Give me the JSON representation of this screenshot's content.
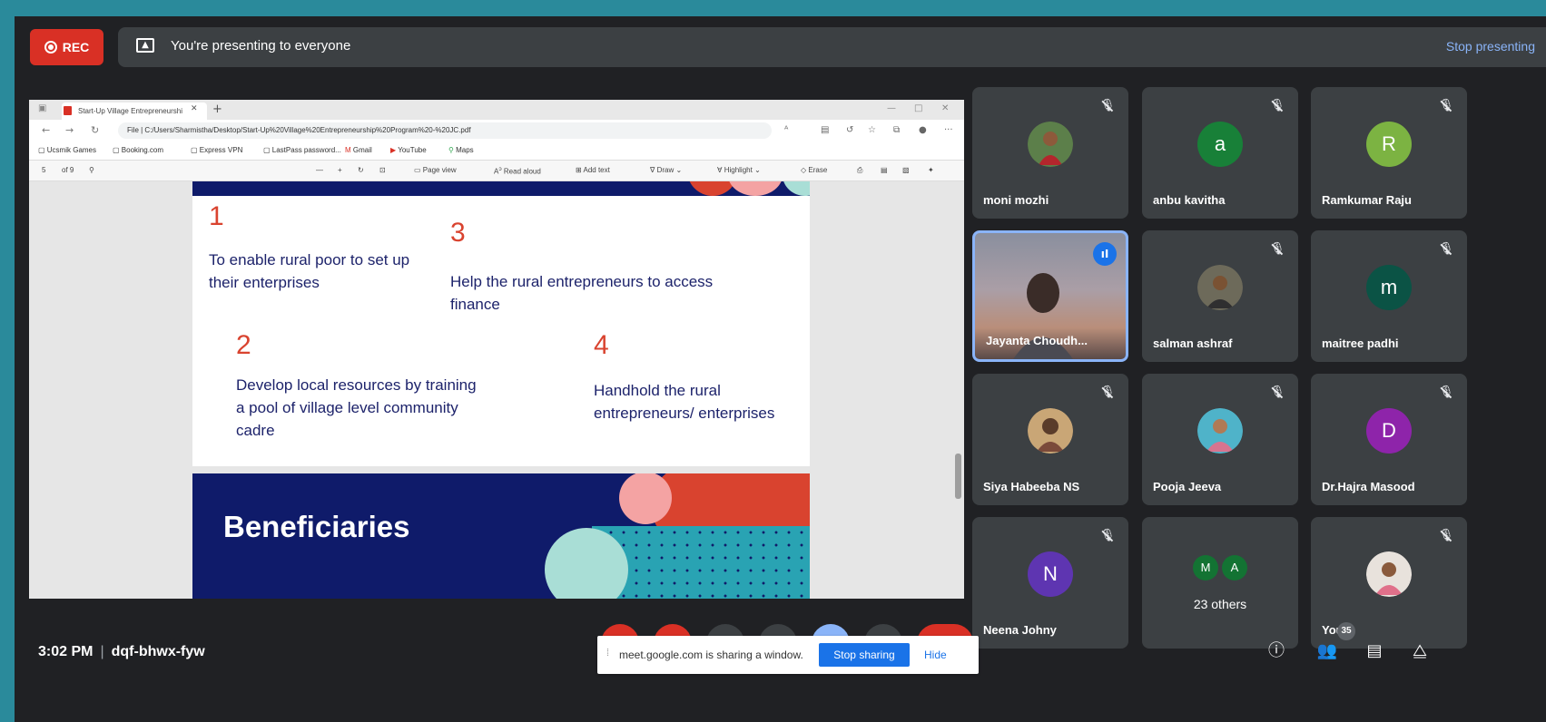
{
  "banner": {
    "rec_label": "REC",
    "presenting_text": "You're presenting to everyone",
    "stop_presenting": "Stop presenting"
  },
  "browser": {
    "tab_title": "Start-Up Village Entrepreneurshi",
    "url": "File  |  C:/Users/Sharmistha/Desktop/Start-Up%20Village%20Entrepreneurship%20Program%20-%20JC.pdf",
    "bookmarks": [
      "Ucsmik Games",
      "Booking.com",
      "Express VPN",
      "LastPass password...",
      "Gmail",
      "YouTube",
      "Maps"
    ],
    "pdf_toolbar": {
      "page": "5",
      "of_pages": "of 9",
      "page_view": "Page view",
      "read_aloud": "Read aloud",
      "add_text": "Add text",
      "draw": "Draw",
      "highlight": "Highlight",
      "erase": "Erase"
    }
  },
  "slide": {
    "objectives": [
      {
        "num": "1",
        "text": "To enable rural poor to set up their enterprises"
      },
      {
        "num": "2",
        "text": "Develop local resources by training a pool of village level community cadre"
      },
      {
        "num": "3",
        "text": "Help the rural entrepreneurs to access finance"
      },
      {
        "num": "4",
        "text": "Handhold the rural entrepreneurs/ enterprises"
      }
    ],
    "next_heading": "Beneficiaries",
    "colors": {
      "navy": "#0f1b6a",
      "red": "#d9432f",
      "pink": "#f4a3a3",
      "mint": "#a9ded6",
      "teal": "#29a3b3"
    }
  },
  "participants": [
    {
      "name": "moni mozhi",
      "avatar": "photo",
      "muted": true
    },
    {
      "name": "anbu kavitha",
      "avatar": "a",
      "color": "#188038",
      "muted": true
    },
    {
      "name": "Ramkumar Raju",
      "avatar": "R",
      "color": "#7cb342",
      "muted": true
    },
    {
      "name": "Jayanta Choudh...",
      "avatar": "video",
      "speaking": true
    },
    {
      "name": "salman ashraf",
      "avatar": "photo",
      "muted": true
    },
    {
      "name": "maitree padhi",
      "avatar": "m",
      "color": "#0b5345",
      "muted": true
    },
    {
      "name": "Siya Habeeba NS",
      "avatar": "photo",
      "muted": true
    },
    {
      "name": "Pooja Jeeva",
      "avatar": "photo",
      "muted": true
    },
    {
      "name": "Dr.Hajra Masood",
      "avatar": "D",
      "color": "#8e24aa",
      "muted": true
    },
    {
      "name": "Neena Johny",
      "avatar": "N",
      "color": "#5e35b1",
      "muted": true
    },
    {
      "name": "23 others",
      "avatars": [
        "M",
        "A"
      ]
    },
    {
      "name": "You",
      "avatar": "photo",
      "muted": true
    }
  ],
  "footer": {
    "time": "3:02 PM",
    "meeting_code": "dqf-bhwx-fyw",
    "share_notice": "meet.google.com is sharing a window.",
    "stop_sharing": "Stop sharing",
    "hide": "Hide",
    "participant_count": "35"
  }
}
